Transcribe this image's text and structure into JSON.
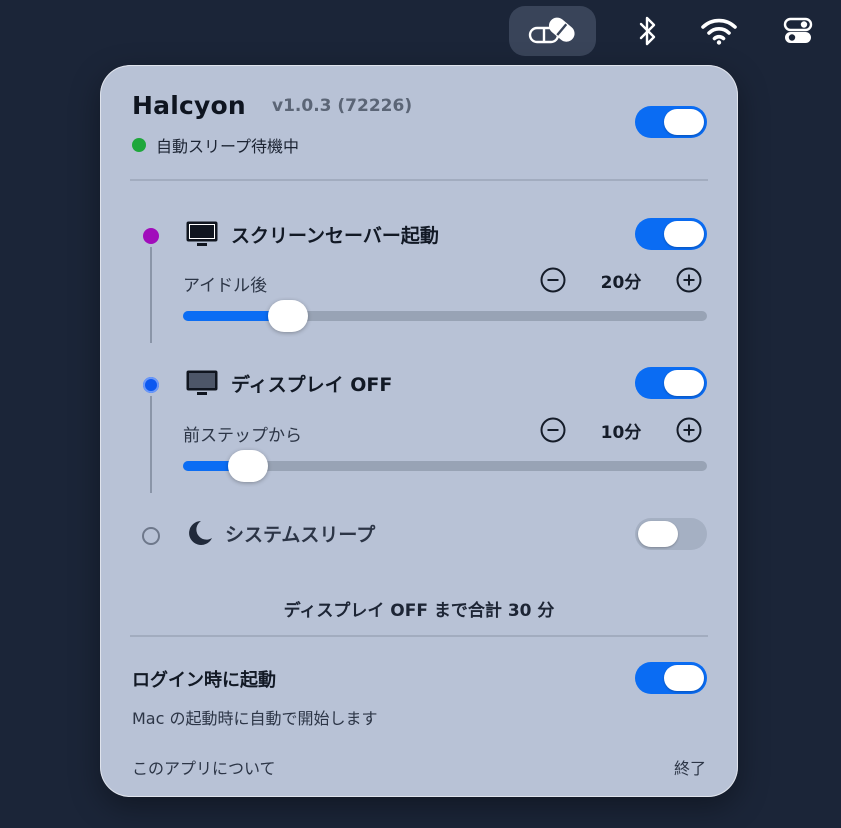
{
  "menubar": {
    "icons": [
      "pills-icon",
      "bluetooth-icon",
      "wifi-icon",
      "control-center-icon"
    ]
  },
  "app": {
    "name": "Halcyon",
    "version": "v1.0.3 (72226)",
    "status": "自動スリープ待機中",
    "enabled": true
  },
  "steps": [
    {
      "title": "スクリーンセーバー起動",
      "enabled": true,
      "delay_label": "アイドル後",
      "value": "20分",
      "slider_fraction": 0.18
    },
    {
      "title": "ディスプレイ OFF",
      "enabled": true,
      "delay_label": "前ステップから",
      "value": "10分",
      "slider_fraction": 0.1
    },
    {
      "title": "システムスリープ",
      "enabled": false
    }
  ],
  "summary": "ディスプレイ OFF まで合計 30 分",
  "login": {
    "title": "ログイン時に起動",
    "subtitle": "Mac の起動時に自動で開始します",
    "enabled": true
  },
  "footer": {
    "about": "このアプリについて",
    "quit": "終了"
  },
  "colors": {
    "accent": "#0a6cf3",
    "status_green": "#1ea73b",
    "step1_dot": "#a10dbb",
    "step2_dot": "#0c58f0"
  }
}
